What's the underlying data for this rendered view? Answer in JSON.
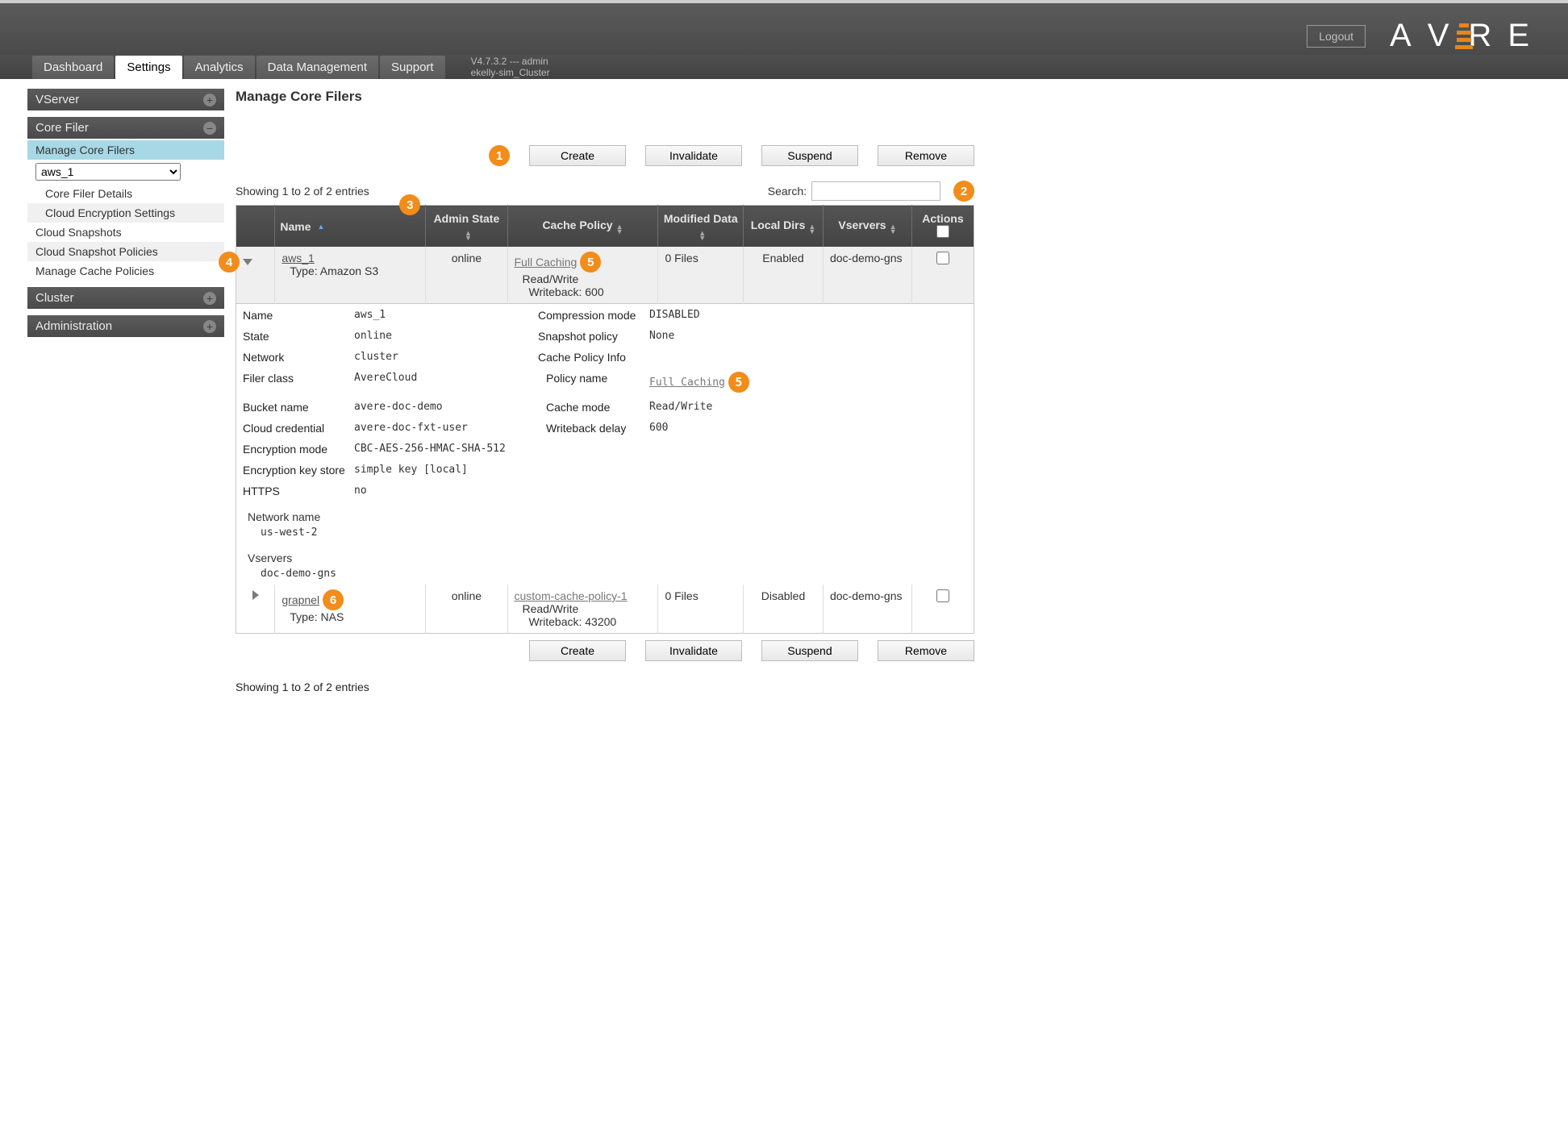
{
  "header": {
    "logout_label": "Logout",
    "logo_letters": [
      "A",
      "V",
      "E",
      "R",
      "E"
    ],
    "version_line": "V4.7.3.2 --- admin",
    "cluster_line": "ekelly-sim_Cluster",
    "tabs": {
      "dashboard": "Dashboard",
      "settings": "Settings",
      "analytics": "Analytics",
      "data_management": "Data Management",
      "support": "Support"
    }
  },
  "sidebar": {
    "groups": {
      "vserver": "VServer",
      "core_filer": "Core Filer",
      "cluster": "Cluster",
      "administration": "Administration"
    },
    "core_filer_items": {
      "manage": "Manage Core Filers",
      "select_value": "aws_1",
      "details": "Core Filer Details",
      "cloud_enc": "Cloud Encryption Settings",
      "cloud_snap": "Cloud Snapshots",
      "cloud_snap_pol": "Cloud Snapshot Policies",
      "cache_pol": "Manage Cache Policies"
    }
  },
  "page": {
    "title": "Manage Core Filers",
    "showing": "Showing 1 to 2 of 2 entries",
    "search_label": "Search:",
    "buttons": {
      "create": "Create",
      "invalidate": "Invalidate",
      "suspend": "Suspend",
      "remove": "Remove"
    },
    "columns": {
      "name": "Name",
      "admin_state": "Admin State",
      "cache_policy": "Cache Policy",
      "modified_data": "Modified Data",
      "local_dirs": "Local Dirs",
      "vservers": "Vservers",
      "actions": "Actions"
    },
    "rows": [
      {
        "name": "aws_1",
        "type_label": "Type: Amazon S3",
        "admin_state": "online",
        "cache_policy_link": "Full Caching",
        "cache_rw": "Read/Write",
        "cache_wb": "Writeback: 600",
        "modified": "0 Files",
        "local_dirs": "Enabled",
        "vservers": "doc-demo-gns"
      },
      {
        "name": "grapnel",
        "type_label": "Type: NAS",
        "admin_state": "online",
        "cache_policy_link": "custom-cache-policy-1",
        "cache_rw": "Read/Write",
        "cache_wb": "Writeback: 43200",
        "modified": "0 Files",
        "local_dirs": "Disabled",
        "vservers": "doc-demo-gns"
      }
    ],
    "details": {
      "labels": {
        "name": "Name",
        "state": "State",
        "network": "Network",
        "filer_class": "Filer class",
        "bucket": "Bucket name",
        "cloud_cred": "Cloud credential",
        "enc_mode": "Encryption mode",
        "enc_key": "Encryption key store",
        "https": "HTTPS",
        "compression": "Compression mode",
        "snapshot_pol": "Snapshot policy",
        "cache_policy_info": "Cache Policy Info",
        "policy_name": "Policy name",
        "cache_mode": "Cache mode",
        "writeback_delay": "Writeback delay",
        "network_name": "Network name",
        "vservers": "Vservers"
      },
      "values": {
        "name": "aws_1",
        "state": "online",
        "network": "cluster",
        "filer_class": "AvereCloud",
        "bucket": "avere-doc-demo",
        "cloud_cred": "avere-doc-fxt-user",
        "enc_mode": "CBC-AES-256-HMAC-SHA-512",
        "enc_key": "simple key [local]",
        "https": "no",
        "compression": "DISABLED",
        "snapshot_pol": "None",
        "policy_name": "Full Caching",
        "cache_mode": "Read/Write",
        "writeback_delay": "600",
        "network_name": "us-west-2",
        "vservers": "doc-demo-gns"
      }
    }
  },
  "annotations": {
    "a1": "1",
    "a2": "2",
    "a3": "3",
    "a4": "4",
    "a5": "5",
    "a6": "6"
  }
}
